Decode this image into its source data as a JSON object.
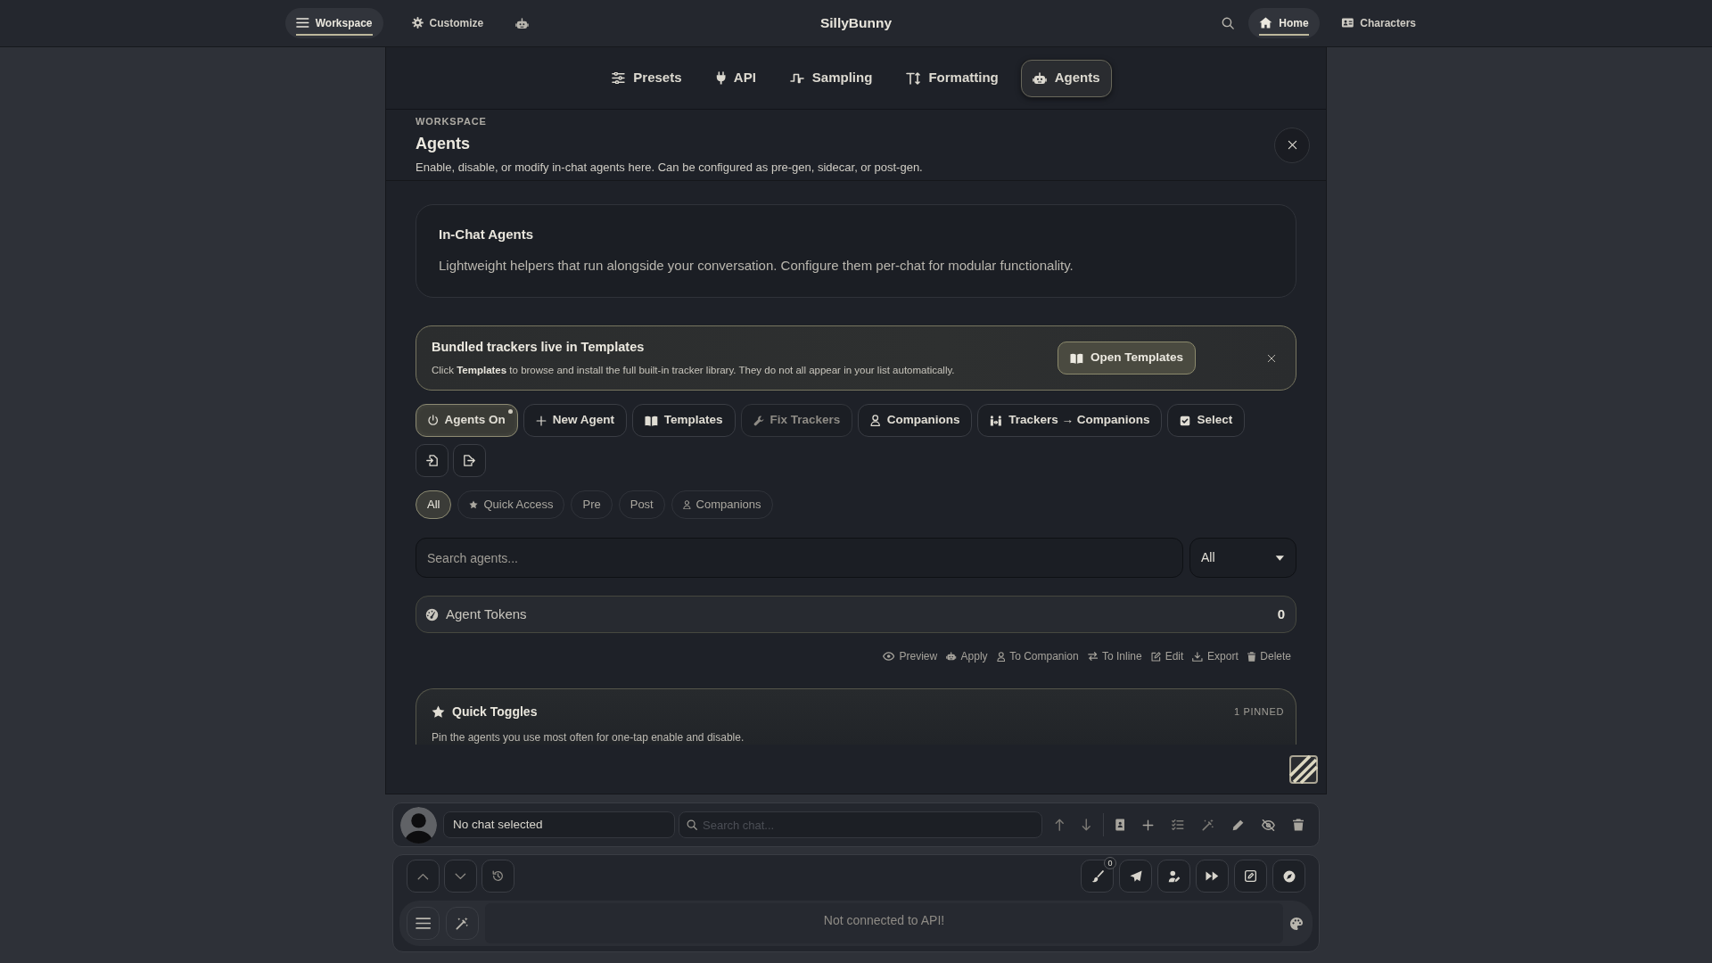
{
  "top_bar": {
    "left_items": [
      {
        "label": "Workspace",
        "selected": true
      },
      {
        "label": "Customize",
        "selected": false
      }
    ],
    "title": "SillyBunny",
    "right_items": [
      {
        "label": "Home",
        "selected": true
      },
      {
        "label": "Characters",
        "selected": false
      }
    ]
  },
  "tabs": [
    {
      "label": "Presets",
      "selected": false
    },
    {
      "label": "API",
      "selected": false
    },
    {
      "label": "Sampling",
      "selected": false
    },
    {
      "label": "Formatting",
      "selected": false
    },
    {
      "label": "Agents",
      "selected": true
    }
  ],
  "header": {
    "eyebrow": "WORKSPACE",
    "title": "Agents",
    "description": "Enable, disable, or modify in-chat agents here. Can be configured as pre-gen, sidecar, or post-gen."
  },
  "intro_card": {
    "title": "In-Chat Agents",
    "text": "Lightweight helpers that run alongside your conversation. Configure them per-chat for modular functionality."
  },
  "banner": {
    "title": "Bundled trackers live in Templates",
    "text": "Click **Templates** to browse and install the full built-in tracker library. They do not all appear in your list automatically.",
    "button": "Open Templates"
  },
  "toolbar": [
    {
      "label": "Agents On",
      "active": true,
      "disabled": false
    },
    {
      "label": "New Agent",
      "active": false,
      "disabled": false
    },
    {
      "label": "Templates",
      "active": false,
      "disabled": false
    },
    {
      "label": "Fix Trackers",
      "active": false,
      "disabled": true
    },
    {
      "label": "Companions",
      "active": false,
      "disabled": false
    },
    {
      "label": "Trackers → Companions",
      "active": false,
      "disabled": false
    },
    {
      "label": "Select",
      "active": false,
      "disabled": false
    }
  ],
  "filters": [
    {
      "label": "All",
      "selected": true
    },
    {
      "label": "Quick Access",
      "selected": false
    },
    {
      "label": "Pre",
      "selected": false
    },
    {
      "label": "Post",
      "selected": false
    },
    {
      "label": "Companions",
      "selected": false
    }
  ],
  "search": {
    "placeholder": "Search agents...",
    "type_filter": "All"
  },
  "tokens": {
    "label": "Agent Tokens",
    "count": "0"
  },
  "actions": [
    "Preview",
    "Apply",
    "To Companion",
    "To Inline",
    "Edit",
    "Export",
    "Delete"
  ],
  "quick_toggles": {
    "title": "Quick Toggles",
    "count": "1 PINNED",
    "text": "Pin the agents you use most often for one-tap enable and disable."
  },
  "chat_bar": {
    "chat_name": "No chat selected",
    "search_placeholder": "Search chat..."
  },
  "composer": {
    "badge": "0",
    "placeholder": "Not connected to API!"
  }
}
